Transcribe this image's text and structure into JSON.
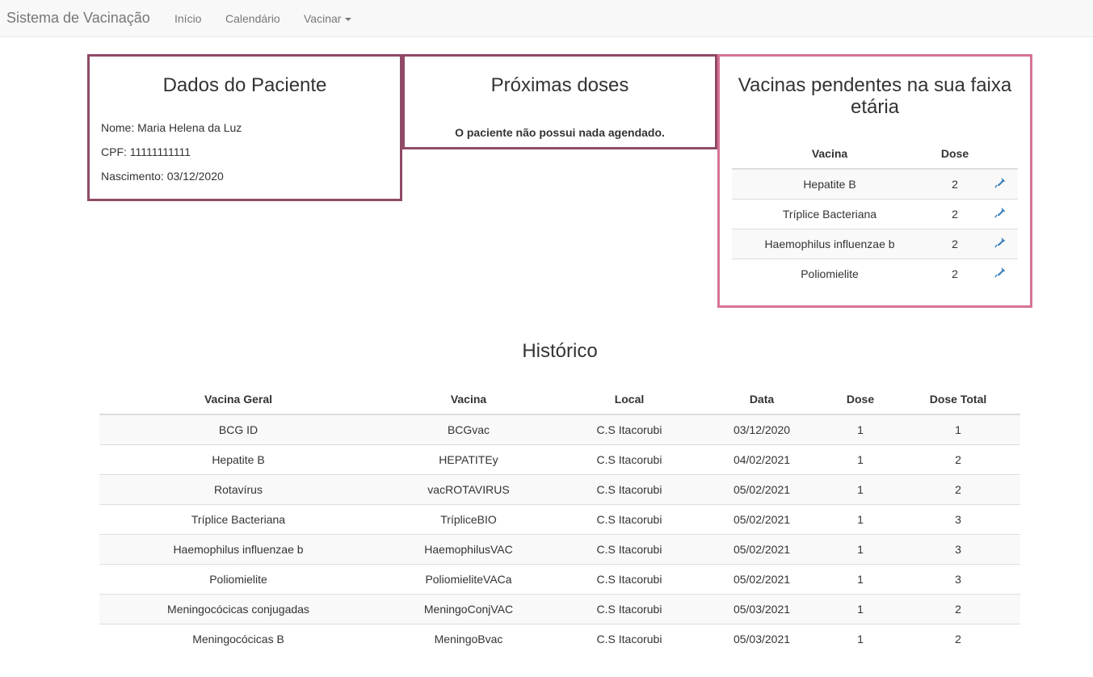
{
  "navbar": {
    "brand": "Sistema de Vacinação",
    "links": [
      {
        "label": "Início"
      },
      {
        "label": "Calendário"
      },
      {
        "label": "Vacinar"
      }
    ]
  },
  "patient": {
    "title": "Dados do Paciente",
    "name_line": "Nome: Maria Helena da Luz",
    "cpf_line": "CPF: 11111111111",
    "birth_line": "Nascimento: 03/12/2020"
  },
  "next_doses": {
    "title": "Próximas doses",
    "empty_message": "O paciente não possui nada agendado."
  },
  "pending": {
    "title": "Vacinas pendentes na sua faixa etária",
    "headers": [
      "Vacina",
      "Dose",
      ""
    ],
    "rows": [
      {
        "vacina": "Hepatite B",
        "dose": "2"
      },
      {
        "vacina": "Tríplice Bacteriana",
        "dose": "2"
      },
      {
        "vacina": "Haemophilus influenzae b",
        "dose": "2"
      },
      {
        "vacina": "Poliomielite",
        "dose": "2"
      }
    ],
    "action_icon": "syringe-icon",
    "icon_color": "#337ab7"
  },
  "history": {
    "title": "Histórico",
    "headers": [
      "Vacina Geral",
      "Vacina",
      "Local",
      "Data",
      "Dose",
      "Dose Total"
    ],
    "rows": [
      [
        "BCG ID",
        "BCGvac",
        "C.S Itacorubi",
        "03/12/2020",
        "1",
        "1"
      ],
      [
        "Hepatite B",
        "HEPATITEy",
        "C.S Itacorubi",
        "04/02/2021",
        "1",
        "2"
      ],
      [
        "Rotavírus",
        "vacROTAVIRUS",
        "C.S Itacorubi",
        "05/02/2021",
        "1",
        "2"
      ],
      [
        "Tríplice Bacteriana",
        "TrípliceBIO",
        "C.S Itacorubi",
        "05/02/2021",
        "1",
        "3"
      ],
      [
        "Haemophilus influenzae b",
        "HaemophilusVAC",
        "C.S Itacorubi",
        "05/02/2021",
        "1",
        "3"
      ],
      [
        "Poliomielite",
        "PoliomieliteVACa",
        "C.S Itacorubi",
        "05/02/2021",
        "1",
        "3"
      ],
      [
        "Meningocócicas conjugadas",
        "MeningoConjVAC",
        "C.S Itacorubi",
        "05/03/2021",
        "1",
        "2"
      ],
      [
        "Meningocócicas B",
        "MeningoBvac",
        "C.S Itacorubi",
        "05/03/2021",
        "1",
        "2"
      ]
    ]
  },
  "colors": {
    "panel_border": "#d77296",
    "panel_border_dark": "#8f4a66",
    "navbar_bg": "#f8f8f8"
  }
}
